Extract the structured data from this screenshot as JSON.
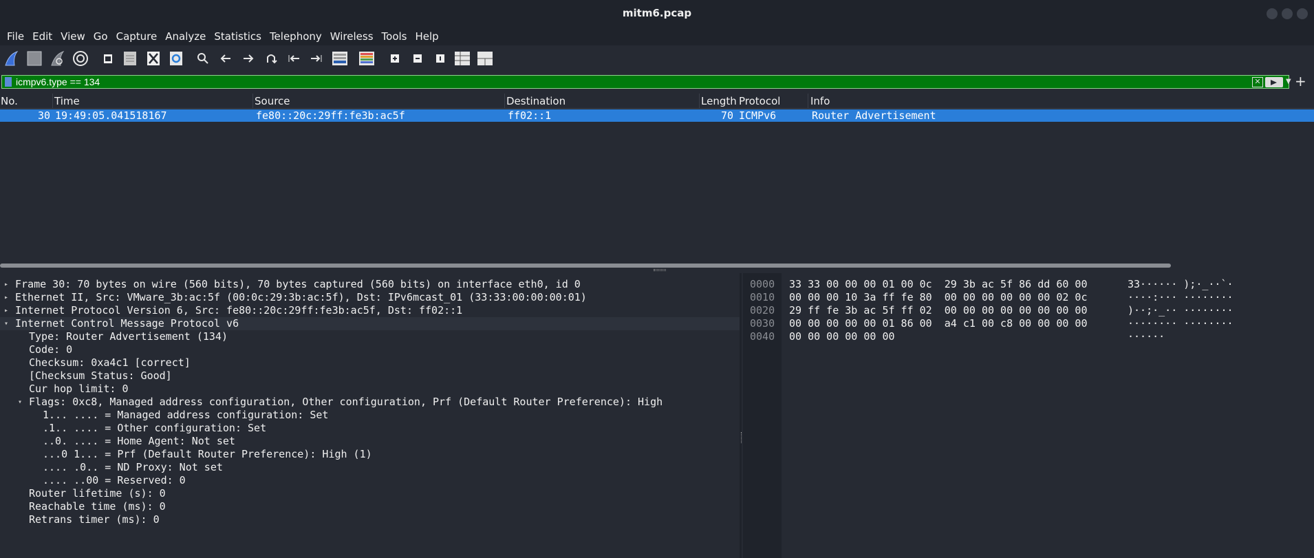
{
  "window": {
    "title": "mitm6.pcap"
  },
  "menu": [
    "File",
    "Edit",
    "View",
    "Go",
    "Capture",
    "Analyze",
    "Statistics",
    "Telephony",
    "Wireless",
    "Tools",
    "Help"
  ],
  "toolbar": {
    "icons": [
      "shark-fin-start-icon",
      "stop-square-icon",
      "restart-fin-icon",
      "capture-options-gear-icon",
      "open-file-icon",
      "save-file-icon",
      "close-file-icon",
      "reload-file-icon",
      "find-packet-icon",
      "go-back-icon",
      "go-forward-icon",
      "go-to-packet-icon",
      "first-packet-icon",
      "last-packet-icon",
      "autoscroll-icon",
      "colorize-icon",
      "zoom-in-icon",
      "zoom-out-icon",
      "normal-size-icon",
      "resize-columns-icon",
      "layout-icon"
    ]
  },
  "filter": {
    "value": "icmpv6.type == 134"
  },
  "packet_list": {
    "columns": [
      "No.",
      "Time",
      "Source",
      "Destination",
      "Length",
      "Protocol",
      "Info"
    ],
    "rows": [
      {
        "no": "30",
        "time": "19:49:05.041518167",
        "source": "fe80::20c:29ff:fe3b:ac5f",
        "destination": "ff02::1",
        "length": "70",
        "protocol": "ICMPv6",
        "info": "Router Advertisement"
      }
    ]
  },
  "details": [
    {
      "indent": 0,
      "arrow": "right",
      "text": "Frame 30: 70 bytes on wire (560 bits), 70 bytes captured (560 bits) on interface eth0, id 0"
    },
    {
      "indent": 0,
      "arrow": "right",
      "text": "Ethernet II, Src: VMware_3b:ac:5f (00:0c:29:3b:ac:5f), Dst: IPv6mcast_01 (33:33:00:00:00:01)"
    },
    {
      "indent": 0,
      "arrow": "right",
      "text": "Internet Protocol Version 6, Src: fe80::20c:29ff:fe3b:ac5f, Dst: ff02::1"
    },
    {
      "indent": 0,
      "arrow": "down",
      "text": "Internet Control Message Protocol v6"
    },
    {
      "indent": 1,
      "arrow": "",
      "text": "Type: Router Advertisement (134)"
    },
    {
      "indent": 1,
      "arrow": "",
      "text": "Code: 0"
    },
    {
      "indent": 1,
      "arrow": "",
      "text": "Checksum: 0xa4c1 [correct]"
    },
    {
      "indent": 1,
      "arrow": "",
      "text": "[Checksum Status: Good]"
    },
    {
      "indent": 1,
      "arrow": "",
      "text": "Cur hop limit: 0"
    },
    {
      "indent": 1,
      "arrow": "down",
      "text": "Flags: 0xc8, Managed address configuration, Other configuration, Prf (Default Router Preference): High"
    },
    {
      "indent": 2,
      "arrow": "",
      "text": "1... .... = Managed address configuration: Set"
    },
    {
      "indent": 2,
      "arrow": "",
      "text": ".1.. .... = Other configuration: Set"
    },
    {
      "indent": 2,
      "arrow": "",
      "text": "..0. .... = Home Agent: Not set"
    },
    {
      "indent": 2,
      "arrow": "",
      "text": "...0 1... = Prf (Default Router Preference): High (1)"
    },
    {
      "indent": 2,
      "arrow": "",
      "text": ".... .0.. = ND Proxy: Not set"
    },
    {
      "indent": 2,
      "arrow": "",
      "text": ".... ..00 = Reserved: 0"
    },
    {
      "indent": 1,
      "arrow": "",
      "text": "Router lifetime (s): 0"
    },
    {
      "indent": 1,
      "arrow": "",
      "text": "Reachable time (ms): 0"
    },
    {
      "indent": 1,
      "arrow": "",
      "text": "Retrans timer (ms): 0"
    }
  ],
  "hex": [
    {
      "offset": "0000",
      "bytes": "33 33 00 00 00 01 00 0c  29 3b ac 5f 86 dd 60 00",
      "ascii": "33······ );·_··`·"
    },
    {
      "offset": "0010",
      "bytes": "00 00 00 10 3a ff fe 80  00 00 00 00 00 00 02 0c",
      "ascii": "····:··· ········"
    },
    {
      "offset": "0020",
      "bytes": "29 ff fe 3b ac 5f ff 02  00 00 00 00 00 00 00 00",
      "ascii": ")··;·_·· ········"
    },
    {
      "offset": "0030",
      "bytes": "00 00 00 00 00 01 86 00  a4 c1 00 c8 00 00 00 00",
      "ascii": "········ ········"
    },
    {
      "offset": "0040",
      "bytes": "00 00 00 00 00 00",
      "ascii": "······"
    }
  ]
}
